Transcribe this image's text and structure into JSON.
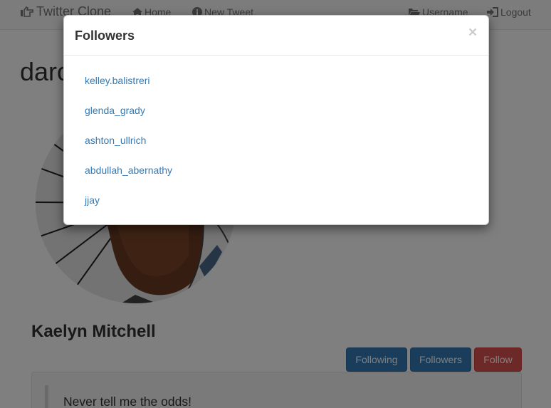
{
  "navbar": {
    "brand": "Twitter Clone",
    "home": "Home",
    "new_tweet": "New Tweet",
    "username": "Username",
    "logout": "Logout"
  },
  "profile": {
    "handle_partial": "darc",
    "name": "Kaelyn Mitchell",
    "buttons": {
      "following": "Following",
      "followers": "Followers",
      "follow": "Follow"
    },
    "tweet_text": "Never tell me the odds!"
  },
  "modal": {
    "title": "Followers",
    "close_label": "×",
    "followers": [
      {
        "username": "kelley.balistreri"
      },
      {
        "username": "glenda_grady"
      },
      {
        "username": "ashton_ullrich"
      },
      {
        "username": "abdullah_abernathy"
      },
      {
        "username": "jjay"
      }
    ]
  },
  "colors": {
    "primary": "#337ab7",
    "danger": "#d9534f",
    "link": "#337ab7"
  },
  "icons": {
    "brand": "thumbs-up-pointing-icon",
    "home": "home-icon",
    "new_tweet": "info-circle-icon",
    "username": "folder-open-icon",
    "logout": "log-in-icon"
  }
}
